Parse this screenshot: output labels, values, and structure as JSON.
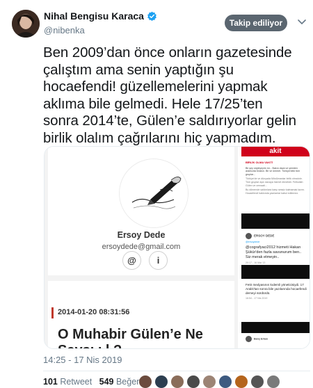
{
  "author": {
    "name": "Nihal Bengisu Karaca",
    "handle": "@nibenka",
    "verified": true,
    "avatar_icon": "user-avatar"
  },
  "follow_button": {
    "label": "Takip ediliyor"
  },
  "tweet": {
    "lines": [
      "Ben 2009’dan önce onların gazetesinde",
      "çalıştım ama senin yaptığın şu",
      "hocaefendi! güzellemelerini yapmak",
      "aklıma bile gelmedi. Hele 17/25’ten",
      "sonra 2014’te, Gülen’e saldırıyorlar gelin",
      "birlik olalım çağrılarını hiç yapmadım."
    ],
    "timestamp": "14:25 - 17 Nis 2019"
  },
  "media": {
    "profile_card": {
      "name": "Ersoy Dede",
      "email": "ersoydede@gmail.com",
      "buttons": [
        "@",
        "i"
      ]
    },
    "article": {
      "date": "2014-01-20 08:31:56",
      "headline_line1": "O Muhabir Gülen’e Ne",
      "headline_line2": "Sayşı ı l ?"
    },
    "right_panel": {
      "site_logo": "akit",
      "headline_small": "BİRLİK OLMA VAKTİ",
      "text_top": "Bir şey söyleyeyim mi... Bakın dava ve yeniden aramızda bırakın. Bir ve ümmet. Türkiye'deki tüm gruplar...",
      "quote_author": "ERSOY DEDE",
      "quote_handle": "@ersoydede",
      "reply_text": "@cografyaci2012 hizmeti Hakan Şükür'den fazla savunurum ben.. Siz merak etmeyin..",
      "reply_meta": "20:17 - 16 Mar 13",
      "mid_text": "Fetö medyasının kıdemli yöneticisiydi. 17 Aralık'tan sonra bile yazılarında hocaefendi demeyi sürdürdü.",
      "mid_meta": "16:54 - 17 Nis 2019",
      "bottom_author": "Barış Erkan"
    }
  },
  "stats": {
    "retweets_count": "101",
    "retweets_label": "Retweet",
    "likes_count": "549",
    "likes_label": "Beğeni"
  },
  "colors": {
    "verified_blue": "#1da1f2",
    "follow_bg": "#5b6670",
    "article_accent": "#c0392b",
    "akit_red": "#d0021b"
  }
}
